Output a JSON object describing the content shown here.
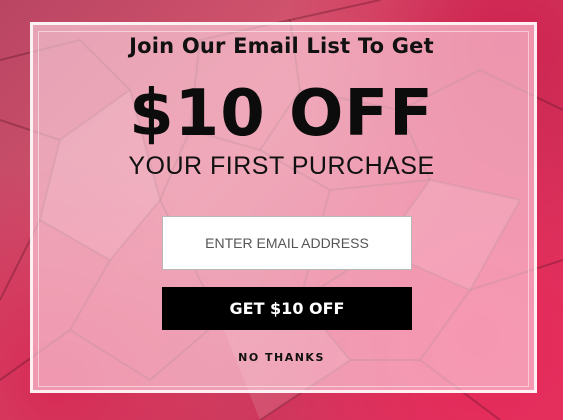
{
  "popup": {
    "headline": "Join Our Email List To Get",
    "offer": "$10 OFF",
    "subline": "YOUR FIRST PURCHASE",
    "email_placeholder": "ENTER EMAIL ADDRESS",
    "submit_label": "GET $10 OFF",
    "dismiss_label": "NO THANKS"
  },
  "colors": {
    "background_accent": "#e0375f",
    "button_bg": "#000000",
    "button_text": "#ffffff"
  }
}
